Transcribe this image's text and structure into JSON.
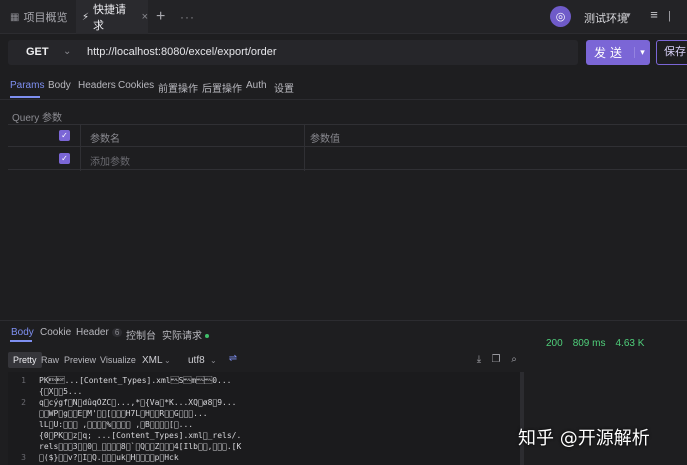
{
  "tabs": [
    {
      "label": "项目概览",
      "icon": "grid-icon"
    },
    {
      "label": "快捷请求",
      "icon": "lightning-icon",
      "active": true
    }
  ],
  "env": {
    "label": "测试环境"
  },
  "request": {
    "method": "GET",
    "url": "http://localhost:8080/excel/export/order",
    "send_label": "发送",
    "save_label": "保存"
  },
  "request_tabs": [
    "Params",
    "Body",
    "Headers",
    "Cookies",
    "前置操作",
    "后置操作",
    "Auth",
    "设置"
  ],
  "params": {
    "section_label": "Query 参数",
    "col_name": "参数名",
    "col_value": "参数值",
    "add_placeholder": "添加参数"
  },
  "response": {
    "tabs": [
      "Body",
      "Cookie",
      "Header",
      "控制台",
      "实际请求"
    ],
    "header_count": "6",
    "status_code": "200",
    "time": "809 ms",
    "size": "4.63 K",
    "formats": [
      "Pretty",
      "Raw",
      "Preview",
      "Visualize"
    ],
    "type": "XML",
    "encoding": "utf8",
    "lines": [
      {
        "no": "1",
        "text": "PK\u0003\u0004...[Content_Types].xml\u0000S\u0000m\u0000\u00000..."
      },
      {
        "no": "",
        "text": "{\u0000X\u0000\u00005..."
      },
      {
        "no": "2",
        "text": "q\u0000cýgf\u0000N\u0000dûqÒZC\u0000...,*\u0000{Va\u0000*K...XQ\u0000ø8\u00009..."
      },
      {
        "no": "",
        "text": "\u0000\u0000WP\u0000g\u0000\u0000E\u0000M'\u0000\u0000[\u0000\u0000\u0000H7L\u0000H\u0000\u0000R\u0000\u0000G\u0000\u0000\u0000..."
      },
      {
        "no": "",
        "text": "lL\u0000U:\u0000\u0000\u0000 ,\u0000\u0000\u0000\u0000%\u0000\u0000\u0000\u0000 ,\u0000B\u0000\u0000\u0000\u0000[\u0000..."
      },
      {
        "no": "",
        "text": "{0\u0000PK\u0000\u0000z\u0000q; ...[Content_Types].xml\u0000_rels/."
      },
      {
        "no": "",
        "text": "rels\u0000\u0000\u00003\u0000\u00000\u0000_\u0000\u0000\u0000\u00008\u0000`\u0000Q\u0000\u0000Z\u0000\u0000\u00004[Ilb\u0000\u0000,\u0000\u0000\u0000.[K"
      },
      {
        "no": "3",
        "text": "\u0000($}\u0000\u0000v?\u0000I\u0000Q.\u0000\u0000\u0000uk\u0000H\u0000\u0000\u0000\u0000p\u0000Hck"
      }
    ]
  },
  "watermark": "知乎 @开源解析"
}
